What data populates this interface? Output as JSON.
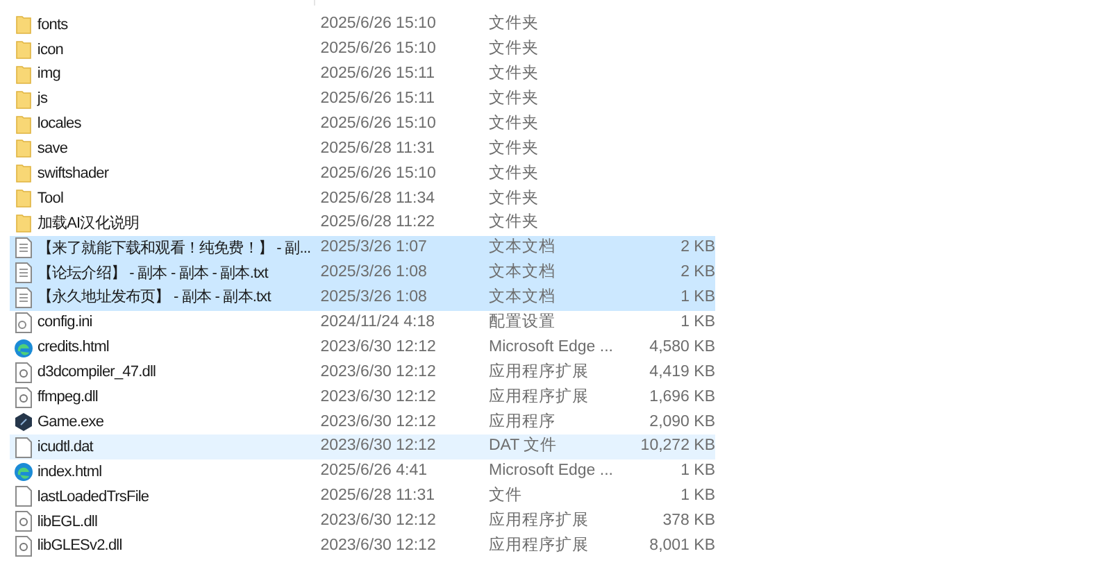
{
  "files": [
    {
      "kind": "folder",
      "name": "fonts",
      "modified": "2025/6/26 15:10",
      "type": "文件夹",
      "selected": false,
      "hovered": false
    },
    {
      "kind": "folder",
      "name": "icon",
      "modified": "2025/6/26 15:10",
      "type": "文件夹",
      "selected": false,
      "hovered": false
    },
    {
      "kind": "folder",
      "name": "img",
      "modified": "2025/6/26 15:11",
      "type": "文件夹",
      "selected": false,
      "hovered": false
    },
    {
      "kind": "folder",
      "name": "js",
      "modified": "2025/6/26 15:11",
      "type": "文件夹",
      "selected": false,
      "hovered": false
    },
    {
      "kind": "folder",
      "name": "locales",
      "modified": "2025/6/26 15:10",
      "type": "文件夹",
      "selected": false,
      "hovered": false
    },
    {
      "kind": "folder",
      "name": "save",
      "modified": "2025/6/28 11:31",
      "type": "文件夹",
      "selected": false,
      "hovered": false
    },
    {
      "kind": "folder",
      "name": "swiftshader",
      "modified": "2025/6/26 15:10",
      "type": "文件夹",
      "selected": false,
      "hovered": false
    },
    {
      "kind": "folder",
      "name": "Tool",
      "modified": "2025/6/28 11:34",
      "type": "文件夹",
      "selected": false,
      "hovered": false
    },
    {
      "kind": "folder",
      "name": "加载AI汉化说明",
      "modified": "2025/6/28 11:22",
      "type": "文件夹",
      "selected": false,
      "hovered": false
    },
    {
      "kind": "text",
      "name": "【来了就能下载和观看！纯免费！】 - 副...",
      "modified": "2025/3/26 1:07",
      "type": "文本文档",
      "size": "2 KB",
      "selected": true,
      "hovered": false
    },
    {
      "kind": "text",
      "name": "【论坛介绍】 - 副本 - 副本 - 副本.txt",
      "modified": "2025/3/26 1:08",
      "type": "文本文档",
      "size": "2 KB",
      "selected": true,
      "hovered": false
    },
    {
      "kind": "text",
      "name": "【永久地址发布页】 - 副本 - 副本.txt",
      "modified": "2025/3/26 1:08",
      "type": "文本文档",
      "size": "1 KB",
      "selected": true,
      "hovered": false
    },
    {
      "kind": "config",
      "name": "config.ini",
      "modified": "2024/11/24 4:18",
      "type": "配置设置",
      "size": "1 KB",
      "selected": false,
      "hovered": false
    },
    {
      "kind": "edge",
      "name": "credits.html",
      "modified": "2023/6/30 12:12",
      "type": "Microsoft Edge ...",
      "size": "4,580 KB",
      "selected": false,
      "hovered": false
    },
    {
      "kind": "dll",
      "name": "d3dcompiler_47.dll",
      "modified": "2023/6/30 12:12",
      "type": "应用程序扩展",
      "size": "4,419 KB",
      "selected": false,
      "hovered": false
    },
    {
      "kind": "dll",
      "name": "ffmpeg.dll",
      "modified": "2023/6/30 12:12",
      "type": "应用程序扩展",
      "size": "1,696 KB",
      "selected": false,
      "hovered": false
    },
    {
      "kind": "exe",
      "name": "Game.exe",
      "modified": "2023/6/30 12:12",
      "type": "应用程序",
      "size": "2,090 KB",
      "selected": false,
      "hovered": false
    },
    {
      "kind": "blank",
      "name": "icudtl.dat",
      "modified": "2023/6/30 12:12",
      "type": "DAT 文件",
      "size": "10,272 KB",
      "selected": false,
      "hovered": true
    },
    {
      "kind": "edge",
      "name": "index.html",
      "modified": "2025/6/26 4:41",
      "type": "Microsoft Edge ...",
      "size": "1 KB",
      "selected": false,
      "hovered": false
    },
    {
      "kind": "blank",
      "name": "lastLoadedTrsFile",
      "modified": "2025/6/28 11:31",
      "type": "文件",
      "size": "1 KB",
      "selected": false,
      "hovered": false
    },
    {
      "kind": "dll",
      "name": "libEGL.dll",
      "modified": "2023/6/30 12:12",
      "type": "应用程序扩展",
      "size": "378 KB",
      "selected": false,
      "hovered": false
    },
    {
      "kind": "dll",
      "name": "libGLESv2.dll",
      "modified": "2023/6/30 12:12",
      "type": "应用程序扩展",
      "size": "8,001 KB",
      "selected": false,
      "hovered": false
    }
  ]
}
